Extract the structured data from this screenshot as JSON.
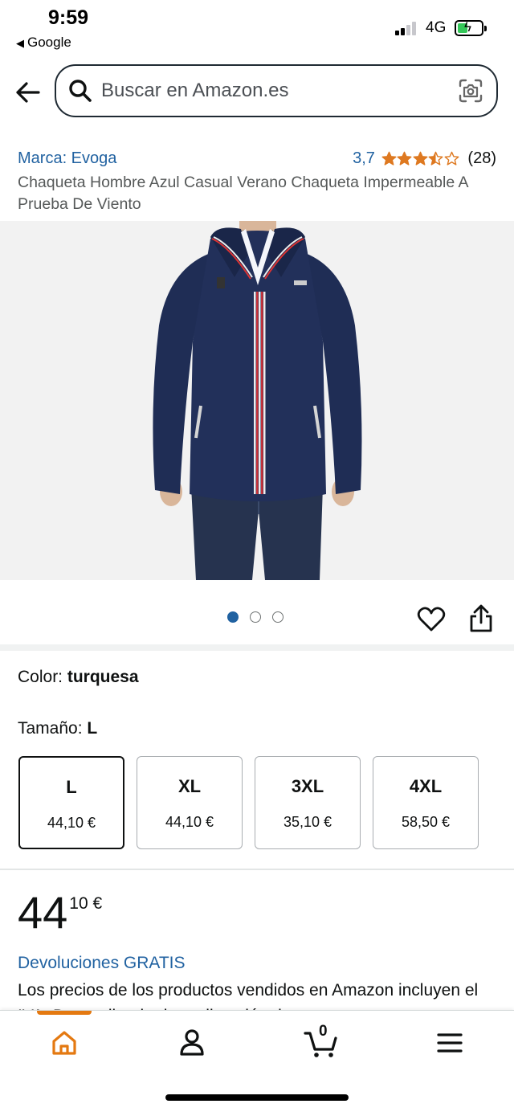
{
  "status_bar": {
    "time": "9:59",
    "back_app": "Google",
    "network": "4G"
  },
  "search": {
    "placeholder": "Buscar en Amazon.es"
  },
  "product": {
    "brand": "Marca: Evoga",
    "rating_value": "3,7",
    "rating_stars": 3.7,
    "rating_count": "(28)",
    "title": "Chaqueta Hombre Azul Casual Verano Chaqueta Impermeable A Prueba De Viento",
    "image_count": 3,
    "active_image": 1
  },
  "variations": {
    "color_label": "Color: ",
    "color_value": "turquesa",
    "size_label": "Tamaño: ",
    "size_value": "L",
    "sizes": [
      {
        "size": "L",
        "price": "44,10 €",
        "selected": true
      },
      {
        "size": "XL",
        "price": "44,10 €",
        "selected": false
      },
      {
        "size": "3XL",
        "price": "35,10 €",
        "selected": false
      },
      {
        "size": "4XL",
        "price": "58,50 €",
        "selected": false
      }
    ]
  },
  "price": {
    "whole": "44",
    "fraction_currency": "10 €"
  },
  "returns": "Devoluciones GRATIS",
  "notice": "Los precios de los productos vendidos en Amazon incluyen el IVA. Dependiendo de tu dirección de entrega",
  "tabbar": {
    "cart_count": "0",
    "accent_color": "#e47911"
  },
  "colors": {
    "link": "#2162a1",
    "star": "#de7921",
    "jacket": "#1e2c52"
  }
}
